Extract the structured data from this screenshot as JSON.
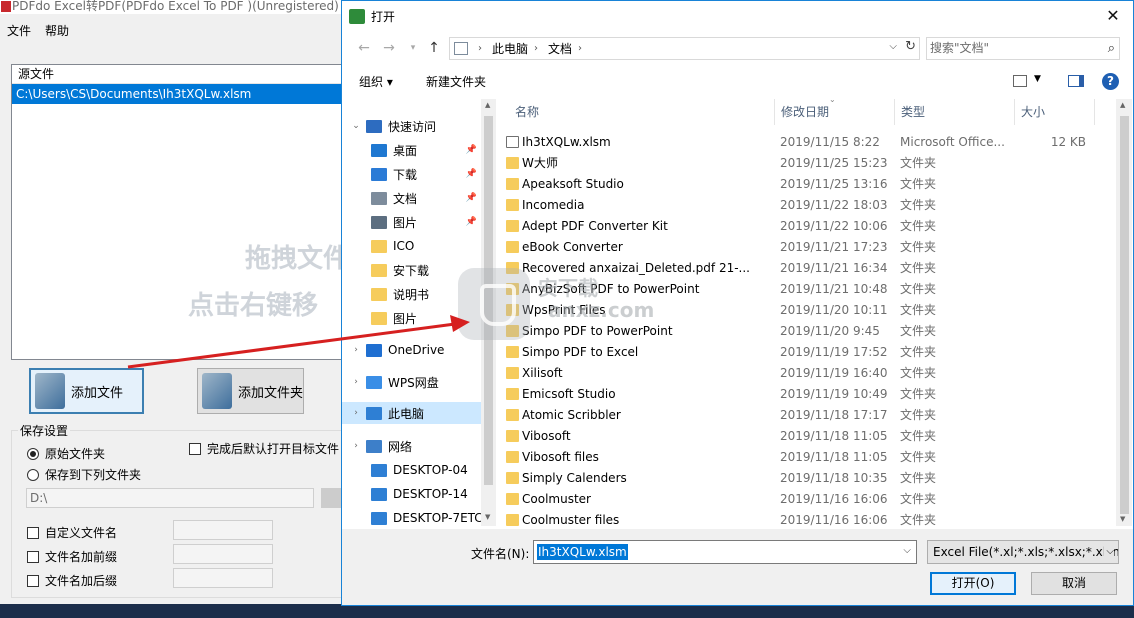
{
  "app": {
    "title": "PDFdo Excel转PDF(PDFdo Excel To PDF )(Unregistered) v",
    "menu": [
      "文件",
      "帮助"
    ],
    "source_header": "源文件",
    "source_file": "C:\\Users\\CS\\Documents\\Ih3tXQLw.xlsm",
    "watermark_line1": "拖拽文件",
    "watermark_line2": "点击右键移",
    "add_file": "添加文件",
    "add_folder": "添加文件夹",
    "save_settings": "保存设置",
    "radio_original": "原始文件夹",
    "radio_save_to": "保存到下列文件夹",
    "open_after": "完成后默认打开目标文件",
    "dest_path": "D:\\",
    "custom_name": "自定义文件名",
    "prefix": "文件名加前缀",
    "suffix": "文件名加后缀"
  },
  "dialog": {
    "title": "打开",
    "close": "✕",
    "breadcrumb": [
      "此电脑",
      "文档"
    ],
    "search_placeholder": "搜索\"文档\"",
    "organize": "组织 ▾",
    "new_folder": "新建文件夹",
    "help": "?",
    "nav": [
      {
        "label": "快速访问",
        "icon": "star-icon",
        "color": "#2d6cc0",
        "level": 0,
        "pin": false
      },
      {
        "label": "桌面",
        "icon": "desktop-icon",
        "color": "#1f78d1",
        "level": 1,
        "pin": true
      },
      {
        "label": "下载",
        "icon": "download-icon",
        "color": "#2b7bd6",
        "level": 1,
        "pin": true
      },
      {
        "label": "文档",
        "icon": "document-icon",
        "color": "#7d8c9c",
        "level": 1,
        "pin": true
      },
      {
        "label": "图片",
        "icon": "pictures-icon",
        "color": "#5c6e80",
        "level": 1,
        "pin": true
      },
      {
        "label": "ICO",
        "icon": "folder-icon",
        "color": "#f6cc5c",
        "level": 1,
        "pin": false
      },
      {
        "label": "安下载",
        "icon": "folder-icon",
        "color": "#f6cc5c",
        "level": 1,
        "pin": false
      },
      {
        "label": "说明书",
        "icon": "folder-icon",
        "color": "#f6cc5c",
        "level": 1,
        "pin": false
      },
      {
        "label": "图片",
        "icon": "folder-icon",
        "color": "#f6cc5c",
        "level": 1,
        "pin": false
      },
      {
        "label": "OneDrive",
        "icon": "cloud-icon",
        "color": "#1f6fd1",
        "level": 0,
        "pin": false
      },
      {
        "label": "WPS网盘",
        "icon": "wps-cloud-icon",
        "color": "#3a8ee6",
        "level": 0,
        "pin": false
      },
      {
        "label": "此电脑",
        "icon": "computer-icon",
        "color": "#2e7fd4",
        "level": 0,
        "pin": false,
        "selected": true
      },
      {
        "label": "网络",
        "icon": "network-icon",
        "color": "#3d7fc9",
        "level": 0,
        "pin": false
      },
      {
        "label": "DESKTOP-04",
        "icon": "computer-icon",
        "color": "#2e7fd4",
        "level": 1,
        "pin": false
      },
      {
        "label": "DESKTOP-14",
        "icon": "computer-icon",
        "color": "#2e7fd4",
        "level": 1,
        "pin": false
      },
      {
        "label": "DESKTOP-7ETC",
        "icon": "computer-icon",
        "color": "#2e7fd4",
        "level": 1,
        "pin": false
      }
    ],
    "columns": [
      "名称",
      "修改日期",
      "类型",
      "大小"
    ],
    "files": [
      {
        "name": "Ih3tXQLw.xlsm",
        "date": "2019/11/15 8:22",
        "type": "Microsoft Office...",
        "size": "12 KB",
        "kind": "xls"
      },
      {
        "name": "W大师",
        "date": "2019/11/25 15:23",
        "type": "文件夹",
        "size": "",
        "kind": "folder"
      },
      {
        "name": "Apeaksoft Studio",
        "date": "2019/11/25 13:16",
        "type": "文件夹",
        "size": "",
        "kind": "folder"
      },
      {
        "name": "Incomedia",
        "date": "2019/11/22 18:03",
        "type": "文件夹",
        "size": "",
        "kind": "folder"
      },
      {
        "name": "Adept PDF Converter Kit",
        "date": "2019/11/22 10:06",
        "type": "文件夹",
        "size": "",
        "kind": "folder"
      },
      {
        "name": "eBook Converter",
        "date": "2019/11/21 17:23",
        "type": "文件夹",
        "size": "",
        "kind": "folder"
      },
      {
        "name": "Recovered anxaizai_Deleted.pdf 21-...",
        "date": "2019/11/21 16:34",
        "type": "文件夹",
        "size": "",
        "kind": "folder"
      },
      {
        "name": "AnyBizSoft PDF to PowerPoint",
        "date": "2019/11/21 10:48",
        "type": "文件夹",
        "size": "",
        "kind": "folder"
      },
      {
        "name": "WpsPrint Files",
        "date": "2019/11/20 10:11",
        "type": "文件夹",
        "size": "",
        "kind": "folder"
      },
      {
        "name": "Simpo PDF to PowerPoint",
        "date": "2019/11/20 9:45",
        "type": "文件夹",
        "size": "",
        "kind": "folder"
      },
      {
        "name": "Simpo PDF to Excel",
        "date": "2019/11/19 17:52",
        "type": "文件夹",
        "size": "",
        "kind": "folder"
      },
      {
        "name": "Xilisoft",
        "date": "2019/11/19 16:40",
        "type": "文件夹",
        "size": "",
        "kind": "folder"
      },
      {
        "name": "Emicsoft Studio",
        "date": "2019/11/19 10:49",
        "type": "文件夹",
        "size": "",
        "kind": "folder"
      },
      {
        "name": "Atomic Scribbler",
        "date": "2019/11/18 17:17",
        "type": "文件夹",
        "size": "",
        "kind": "folder"
      },
      {
        "name": "Vibosoft",
        "date": "2019/11/18 11:05",
        "type": "文件夹",
        "size": "",
        "kind": "folder"
      },
      {
        "name": "Vibosoft files",
        "date": "2019/11/18 11:05",
        "type": "文件夹",
        "size": "",
        "kind": "folder"
      },
      {
        "name": "Simply Calenders",
        "date": "2019/11/18 10:35",
        "type": "文件夹",
        "size": "",
        "kind": "folder"
      },
      {
        "name": "Coolmuster",
        "date": "2019/11/16 16:06",
        "type": "文件夹",
        "size": "",
        "kind": "folder"
      },
      {
        "name": "Coolmuster files",
        "date": "2019/11/16 16:06",
        "type": "文件夹",
        "size": "",
        "kind": "folder"
      }
    ],
    "filename_label": "文件名(N):",
    "filename_value": "Ih3tXQLw.xlsm",
    "filter": "Excel File(*.xl;*.xls;*.xlsx;*.xlsm",
    "open": "打开(O)",
    "cancel": "取消"
  },
  "watermark": {
    "site_line1": "安下载",
    "site_line2": "anxz.com"
  }
}
